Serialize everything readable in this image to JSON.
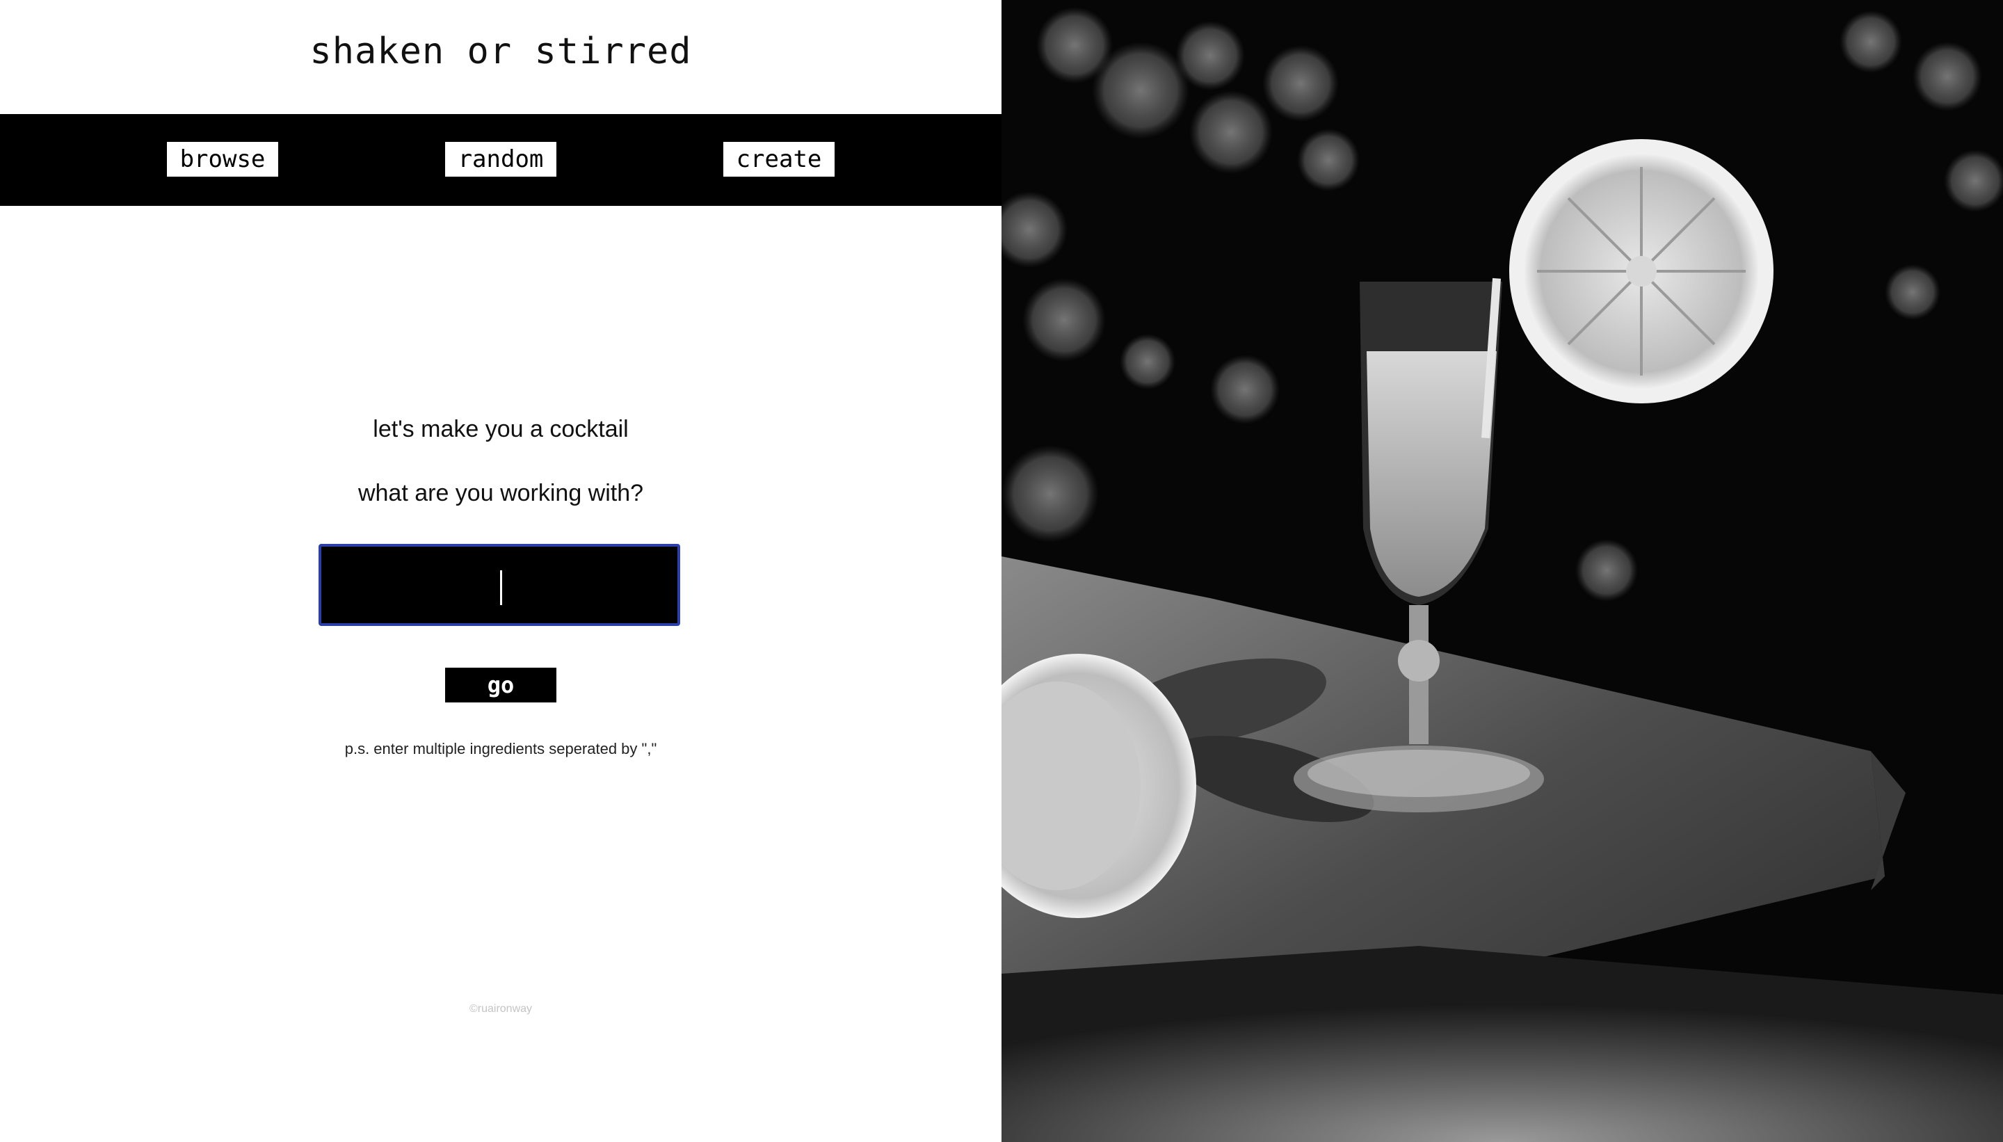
{
  "header": {
    "title": "shaken or stirred"
  },
  "nav": {
    "browse_label": "browse",
    "random_label": "random",
    "create_label": "create"
  },
  "main": {
    "heading_1": "let's make you a cocktail",
    "heading_2": "what are you working with?",
    "ingredient_input": {
      "value": "",
      "placeholder": ""
    },
    "go_label": "go",
    "hint": "p.s. enter multiple ingredients seperated by \",\""
  },
  "footer": {
    "credit": "©ruaironway"
  },
  "hero_image": {
    "description_icon": "cocktail-photo-icon",
    "style": "black-and-white"
  },
  "colors": {
    "nav_background": "#000000",
    "input_border": "#2b3fa8",
    "text": "#111111"
  }
}
